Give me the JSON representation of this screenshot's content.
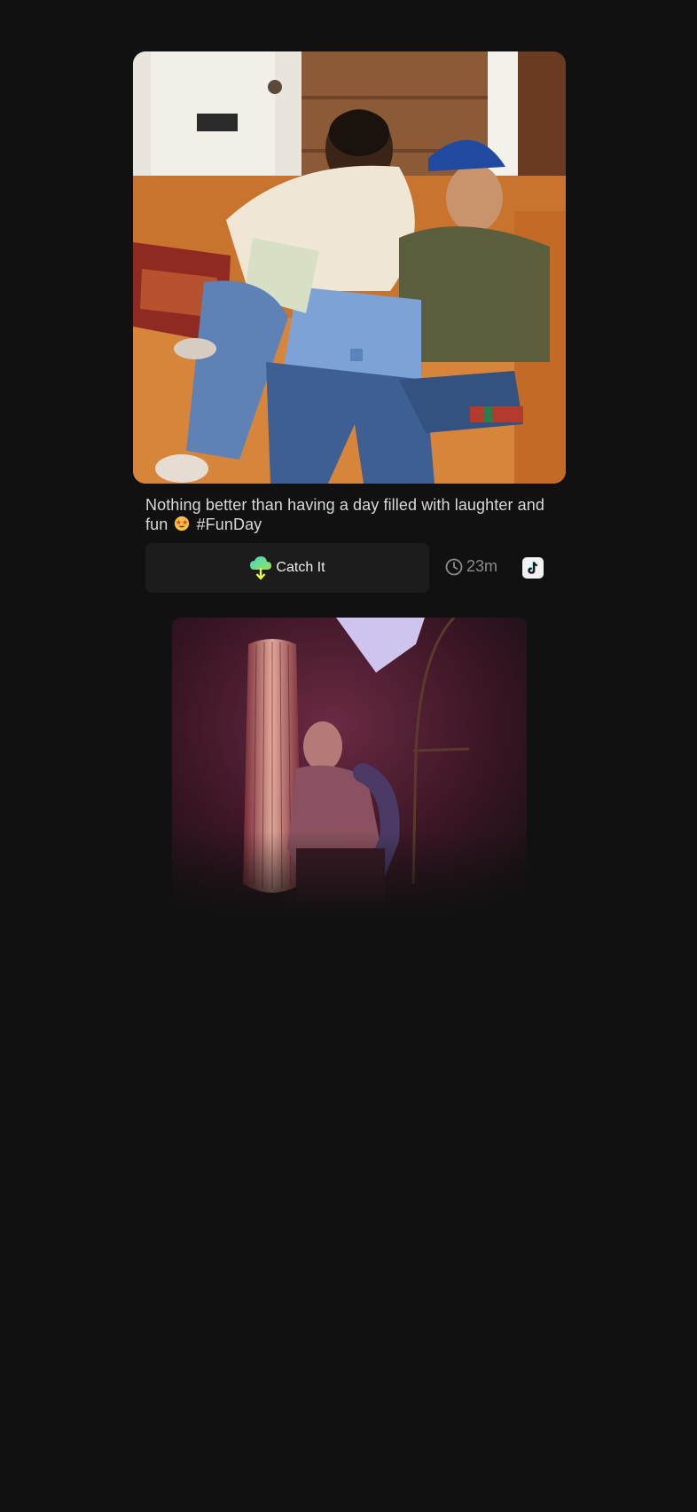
{
  "posts": [
    {
      "image_alt": "Two friends laughing on an orange couch with a laptop and a gift bag",
      "caption_text": "Nothing better than having a day filled with laughter and fun",
      "caption_emoji": "star-struck-emoji",
      "caption_hashtag": "#FunDay",
      "catch_label": "Catch It",
      "time_ago": "23m",
      "platform_icon": "tiktok-icon"
    },
    {
      "image_alt": "Man sitting between a tall lamp and a floor lamp in pink light"
    }
  ],
  "colors": {
    "background": "#111111",
    "button_bg": "#1c1c1c",
    "caption_text": "#d9d9d9",
    "meta_text": "#8c8c8c"
  }
}
